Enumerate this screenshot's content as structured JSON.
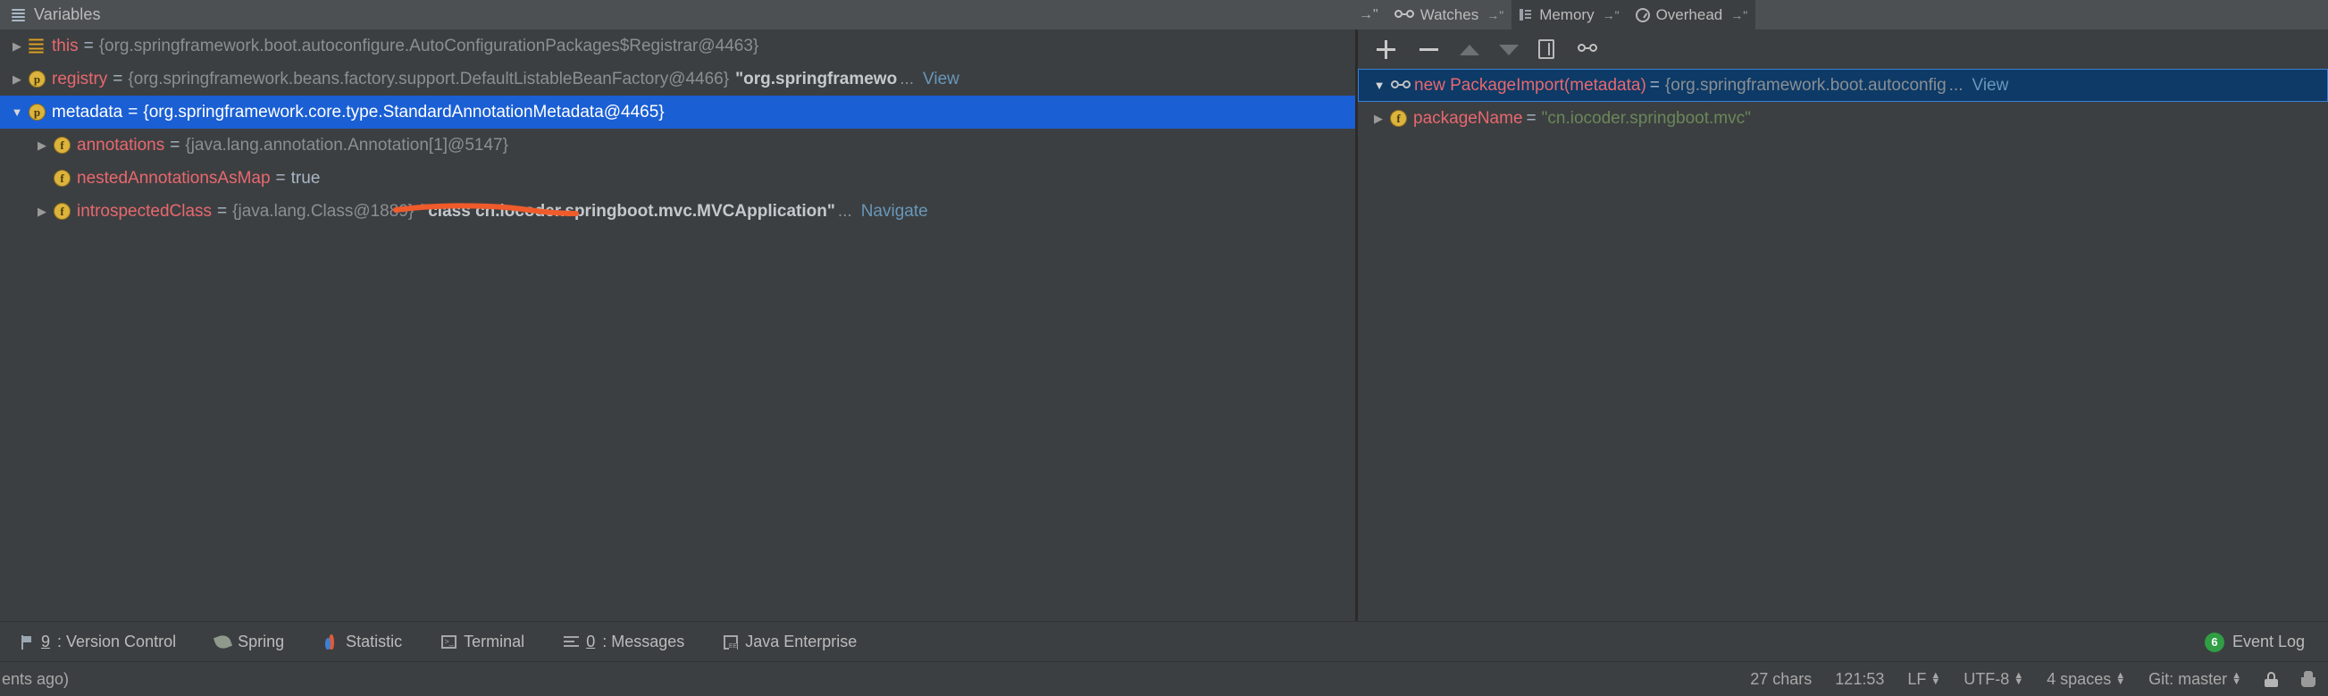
{
  "header": {
    "title": "Variables",
    "title_icon": "lines-icon",
    "pin_icon": "pin-arrow-icon",
    "tabs": [
      {
        "label": "Watches",
        "icon": "glasses-icon",
        "active": true,
        "arrow": "→\""
      },
      {
        "label": "Memory",
        "icon": "memory-icon",
        "active": false,
        "arrow": "→\""
      },
      {
        "label": "Overhead",
        "icon": "gauge-icon",
        "active": false,
        "arrow": "→\""
      }
    ]
  },
  "variables": {
    "rows": [
      {
        "twisty": "collapsed",
        "icon": "frame-icon",
        "name": "this",
        "eq": "=",
        "value": "{org.springframework.boot.autoconfigure.AutoConfigurationPackages$Registrar@4463}",
        "string_value": "",
        "ellipsis": "",
        "link": "",
        "selected": false,
        "indent": 0
      },
      {
        "twisty": "collapsed",
        "icon": "parameter-icon",
        "name": "registry",
        "eq": "=",
        "value": "{org.springframework.beans.factory.support.DefaultListableBeanFactory@4466}",
        "string_value": "\"org.springframewo",
        "ellipsis": "...",
        "link": "View",
        "selected": false,
        "indent": 0
      },
      {
        "twisty": "expanded",
        "icon": "parameter-icon",
        "name": "metadata",
        "eq": "=",
        "value": "{org.springframework.core.type.StandardAnnotationMetadata@4465}",
        "string_value": "",
        "ellipsis": "",
        "link": "",
        "selected": true,
        "indent": 0
      },
      {
        "twisty": "collapsed",
        "icon": "field-icon",
        "name": "annotations",
        "eq": "=",
        "value": "{java.lang.annotation.Annotation[1]@5147}",
        "string_value": "",
        "ellipsis": "",
        "link": "",
        "selected": false,
        "indent": 1
      },
      {
        "twisty": "none",
        "icon": "field-icon",
        "name": "nestedAnnotationsAsMap",
        "eq": "=",
        "value": "true",
        "string_value": "",
        "ellipsis": "",
        "link": "",
        "selected": false,
        "indent": 1
      },
      {
        "twisty": "collapsed",
        "icon": "field-icon",
        "name": "introspectedClass",
        "eq": "=",
        "value": "{java.lang.Class@1889}",
        "string_value": "\"class cn.iocoder.springboot.mvc.MVCApplication\"",
        "ellipsis": "...",
        "link": "Navigate",
        "selected": false,
        "indent": 1
      }
    ]
  },
  "watches": {
    "toolbar": [
      {
        "name": "add-watch",
        "icon": "plus-icon"
      },
      {
        "name": "remove-watch",
        "icon": "minus-icon"
      },
      {
        "name": "move-up",
        "icon": "arrow-up-icon"
      },
      {
        "name": "move-down",
        "icon": "arrow-down-icon"
      },
      {
        "name": "copy-watch",
        "icon": "copy-icon"
      },
      {
        "name": "watches-mode",
        "icon": "glasses-icon"
      }
    ],
    "rows": [
      {
        "twisty": "expanded",
        "icon": "glasses-icon",
        "name": "new PackageImport(metadata)",
        "eq": "=",
        "value": "{org.springframework.boot.autoconfig",
        "ellipsis": "...",
        "link": "View",
        "string_value": "",
        "selected": true,
        "indent": 0
      },
      {
        "twisty": "collapsed",
        "icon": "field-icon",
        "name": "packageName",
        "eq": "=",
        "value": "",
        "string_value": "\"cn.iocoder.springboot.mvc\"",
        "ellipsis": "",
        "link": "",
        "selected": false,
        "indent": 1
      }
    ]
  },
  "bottom_toolwindows": [
    {
      "label_prefix": "9",
      "label": ": Version Control",
      "icon": "vcs-icon"
    },
    {
      "label_prefix": "",
      "label": "Spring",
      "icon": "leaf-icon"
    },
    {
      "label_prefix": "",
      "label": "Statistic",
      "icon": "statistic-icon"
    },
    {
      "label_prefix": "",
      "label": "Terminal",
      "icon": "terminal-icon"
    },
    {
      "label_prefix": "0",
      "label": ": Messages",
      "icon": "messages-icon"
    },
    {
      "label_prefix": "",
      "label": "Java Enterprise",
      "icon": "java-enterprise-icon"
    }
  ],
  "event_log": {
    "count": "6",
    "label": "Event Log"
  },
  "statusbar": {
    "left_text": "ents ago)",
    "items": [
      {
        "label": "27 chars",
        "stepper": false
      },
      {
        "label": "121:53",
        "stepper": false
      },
      {
        "label": "LF",
        "stepper": true
      },
      {
        "label": "UTF-8",
        "stepper": true
      },
      {
        "label": "4 spaces",
        "stepper": true
      },
      {
        "label": "Git: master",
        "stepper": true
      }
    ],
    "lock_icon": "lock-icon",
    "hector_icon": "hector-icon"
  },
  "annotation": {
    "color": "#ef5b2b",
    "target_text": "cn.iocoder.springboot.mvc.MVCApp"
  }
}
